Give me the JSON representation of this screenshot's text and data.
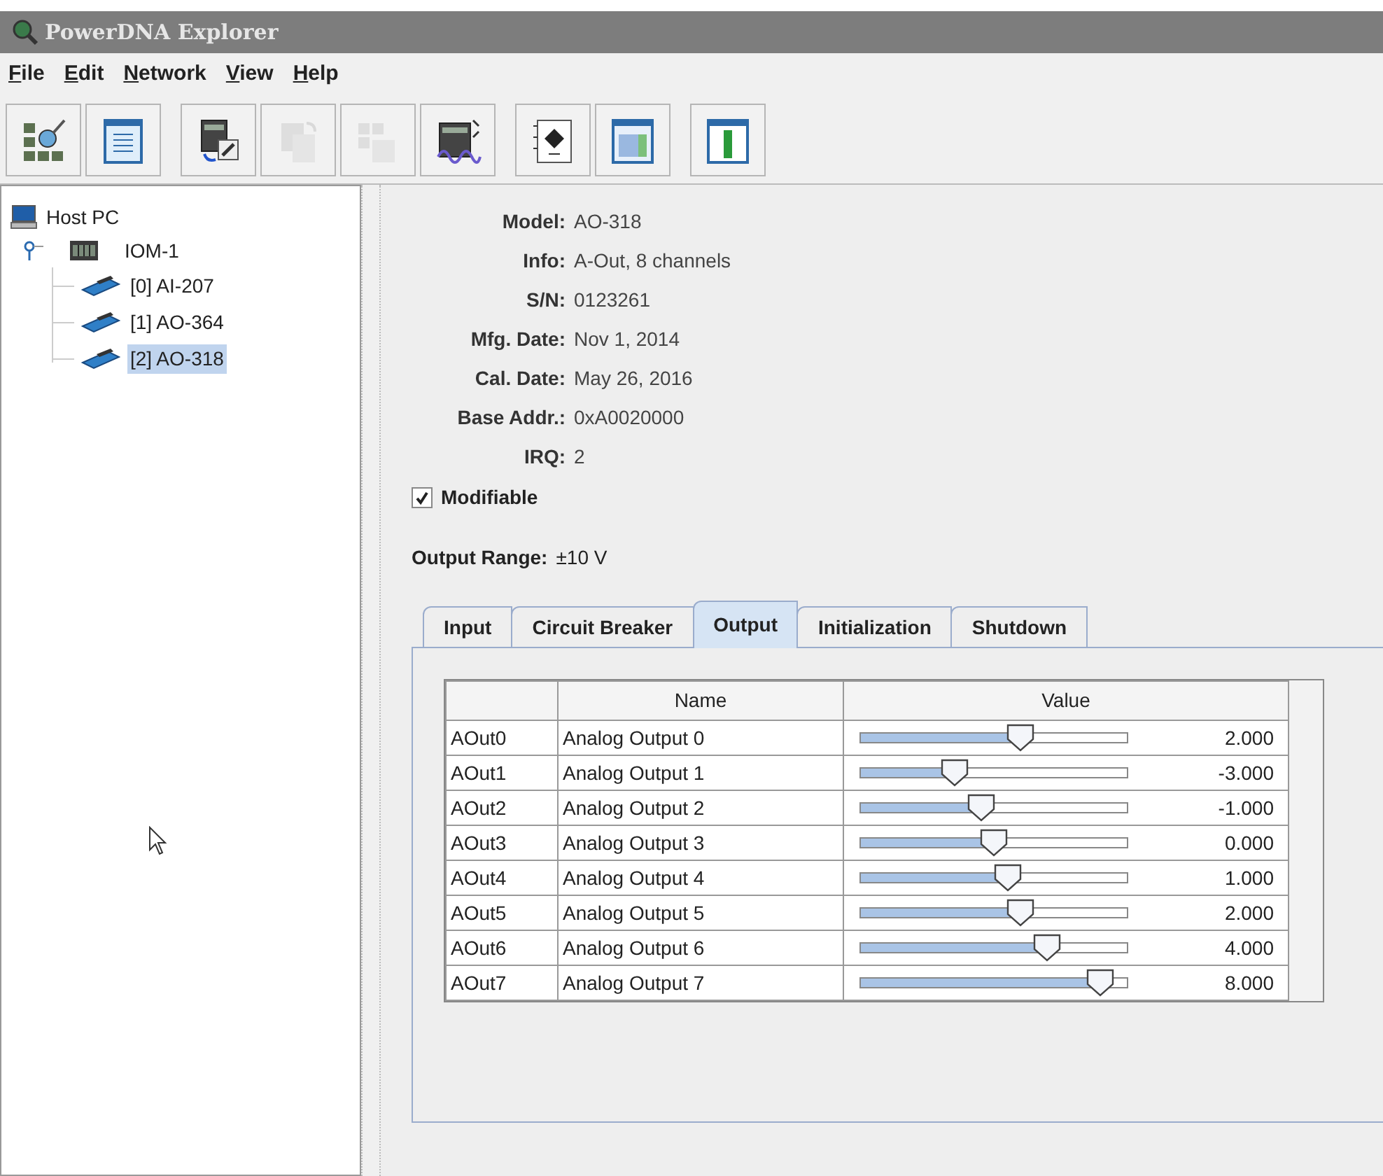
{
  "window": {
    "title": "PowerDNA Explorer"
  },
  "menu": [
    {
      "mnemonic": "F",
      "rest": "ile"
    },
    {
      "mnemonic": "E",
      "rest": "dit"
    },
    {
      "mnemonic": "N",
      "rest": "etwork"
    },
    {
      "mnemonic": "V",
      "rest": "iew"
    },
    {
      "mnemonic": "H",
      "rest": "elp"
    }
  ],
  "toolbar": [
    [
      {
        "kind": "network",
        "disabled": false
      },
      {
        "kind": "form",
        "disabled": false
      }
    ],
    [
      {
        "kind": "device-tools",
        "disabled": false
      },
      {
        "kind": "copy",
        "disabled": true
      },
      {
        "kind": "copy-multi",
        "disabled": true
      },
      {
        "kind": "wave",
        "disabled": false
      }
    ],
    [
      {
        "kind": "notebook",
        "disabled": false
      },
      {
        "kind": "grid",
        "disabled": false
      }
    ],
    [
      {
        "kind": "bar",
        "disabled": false
      }
    ]
  ],
  "tree": {
    "label": "Host PC",
    "selected": false,
    "children": [
      {
        "label": "IOM-1",
        "selected": false,
        "expanded": true,
        "children": [
          {
            "label": "[0] AI-207",
            "selected": false
          },
          {
            "label": "[1] AO-364",
            "selected": false
          },
          {
            "label": "[2] AO-318",
            "selected": true
          }
        ]
      }
    ]
  },
  "details": [
    {
      "label": "Model:",
      "value": "AO-318"
    },
    {
      "label": "Info:",
      "value": "A-Out, 8 channels"
    },
    {
      "label": "S/N:",
      "value": "0123261"
    },
    {
      "label": "Mfg. Date:",
      "value": "Nov 1, 2014"
    },
    {
      "label": "Cal. Date:",
      "value": "May 26, 2016"
    },
    {
      "label": "Base Addr.:",
      "value": "0xA0020000"
    },
    {
      "label": "IRQ:",
      "value": "2"
    }
  ],
  "modifiable": {
    "label": "Modifiable",
    "checked": true
  },
  "output_range": {
    "label": "Output Range:",
    "value": "±10 V"
  },
  "tabs": [
    {
      "label": "Input",
      "selected": false
    },
    {
      "label": "Circuit Breaker",
      "selected": false
    },
    {
      "label": "Output",
      "selected": true
    },
    {
      "label": "Initialization",
      "selected": false
    },
    {
      "label": "Shutdown",
      "selected": false
    }
  ],
  "table": {
    "columns": [
      "Name",
      "Value"
    ],
    "rows": [
      {
        "channel": "AOut0",
        "name": "Analog Output 0",
        "level": 0.6,
        "value": "2.000"
      },
      {
        "channel": "AOut1",
        "name": "Analog Output 1",
        "level": 0.35,
        "value": "-3.000"
      },
      {
        "channel": "AOut2",
        "name": "Analog Output 2",
        "level": 0.45,
        "value": "-1.000"
      },
      {
        "channel": "AOut3",
        "name": "Analog Output 3",
        "level": 0.5,
        "value": "0.000"
      },
      {
        "channel": "AOut4",
        "name": "Analog Output 4",
        "level": 0.55,
        "value": "1.000"
      },
      {
        "channel": "AOut5",
        "name": "Analog Output 5",
        "level": 0.6,
        "value": "2.000"
      },
      {
        "channel": "AOut6",
        "name": "Analog Output 6",
        "level": 0.7,
        "value": "4.000"
      },
      {
        "channel": "AOut7",
        "name": "Analog Output 7",
        "level": 0.9,
        "value": "8.000"
      }
    ]
  }
}
